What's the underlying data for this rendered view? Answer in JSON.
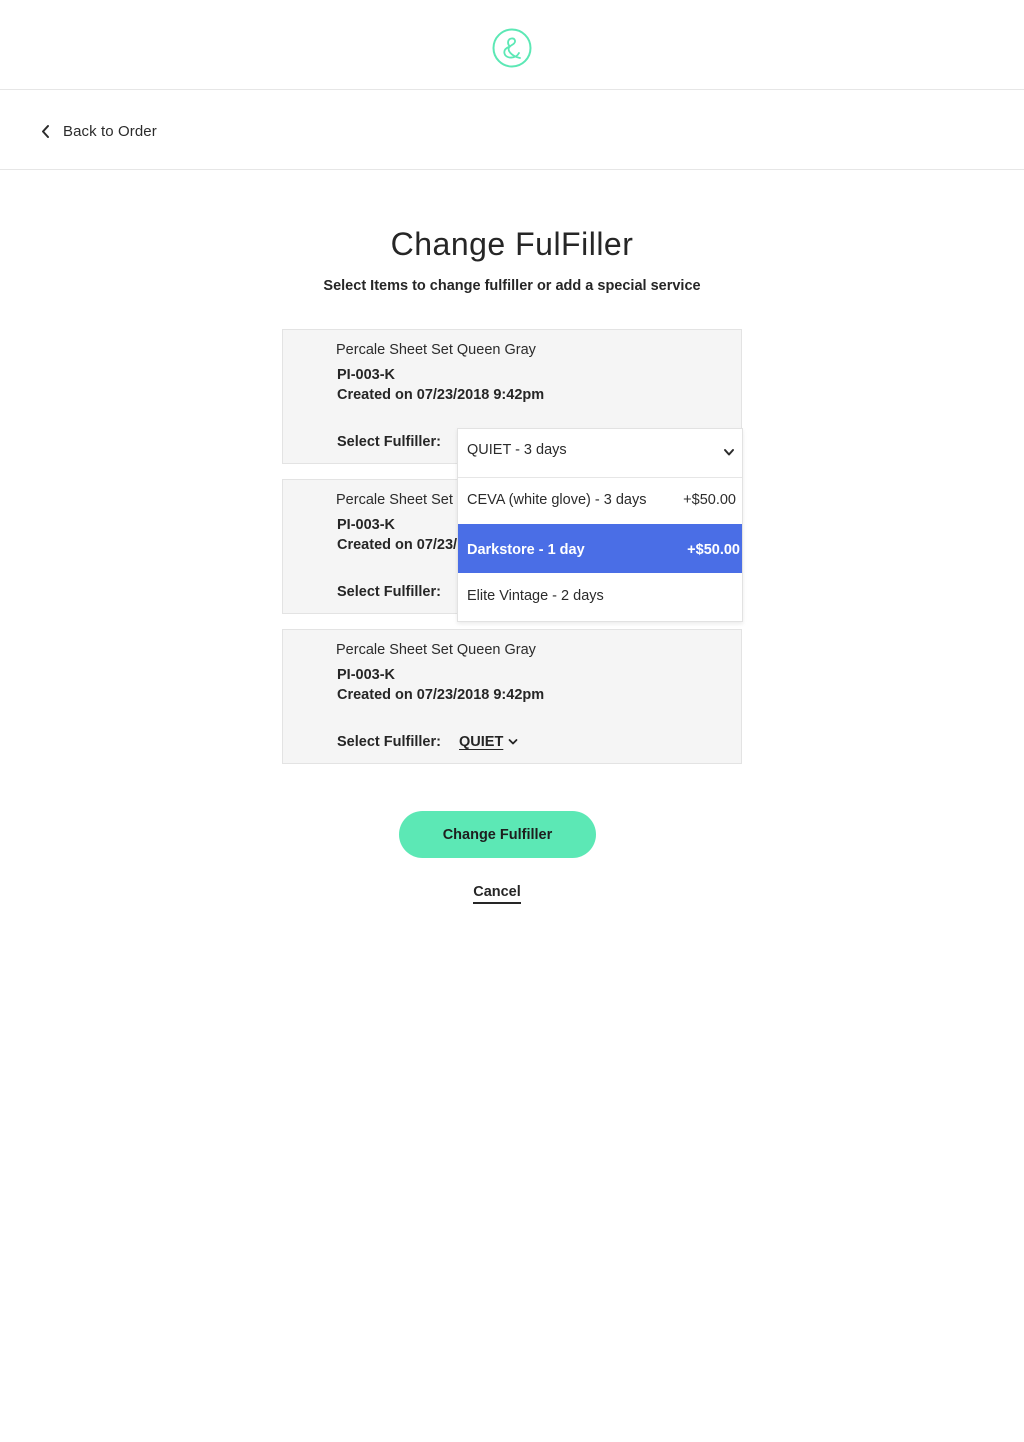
{
  "brand": {
    "logo_icon": "ampersand-logo-icon",
    "accent_color": "#5ce8b5",
    "highlight_color": "#4a6ee6"
  },
  "nav": {
    "back_label": "Back to Order",
    "back_icon": "chevron-left-icon"
  },
  "page": {
    "title": "Change FulFiller",
    "subtitle": "Select Items to change fulfiller or add a special service"
  },
  "items": [
    {
      "name": "Percale Sheet Set Queen Gray",
      "sku": "PI-003-K",
      "created": "Created on 07/23/2018 9:42pm",
      "select_label": "Select Fulfiller:"
    },
    {
      "name": "Percale Sheet Set Queen Gray",
      "sku": "PI-003-K",
      "created": "Created on 07/23/2018 9:42pm",
      "select_label": "Select Fulfiller:"
    },
    {
      "name": "Percale Sheet Set Queen Gray",
      "sku": "PI-003-K",
      "created": "Created on 07/23/2018 9:42pm",
      "select_label": "Select Fulfiller:",
      "fulfiller": "QUIET"
    }
  ],
  "dropdown": {
    "selected": "QUIET - 3 days",
    "options": [
      {
        "label": "CEVA (white glove) - 3 days",
        "price": "+$50.00"
      },
      {
        "label": "Darkstore - 1 day",
        "price": "+$50.00",
        "highlighted": true
      },
      {
        "label": "Elite Vintage - 2 days",
        "price": ""
      }
    ]
  },
  "actions": {
    "primary_label": "Change Fulfiller",
    "cancel_label": "Cancel"
  }
}
